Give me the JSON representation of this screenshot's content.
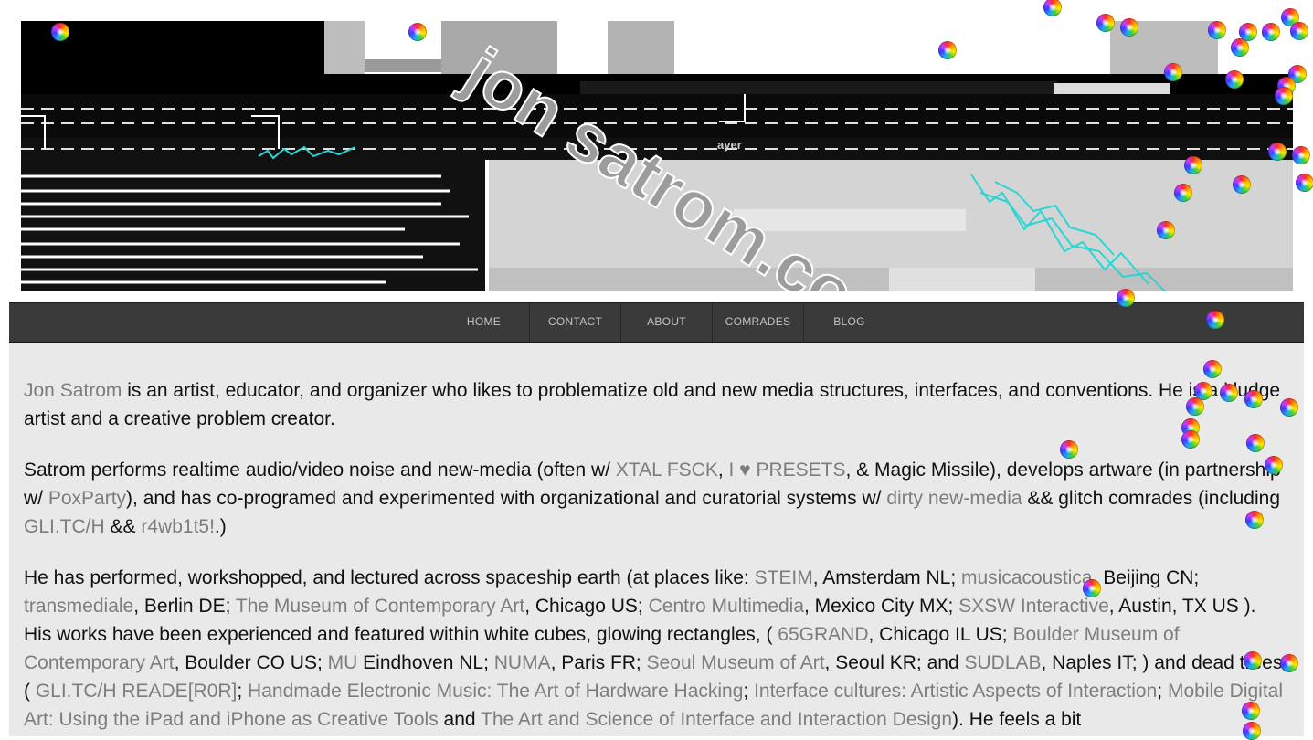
{
  "header": {
    "banner_text": "jon satrom.com",
    "banner_fragment": "ayer"
  },
  "nav": {
    "items": [
      "HOME",
      "CONTACT",
      "ABOUT",
      "COMRADES",
      "BLOG"
    ]
  },
  "intro": {
    "name_link": "Jon Satrom",
    "text_1": " is an artist, educator, and organizer who likes to problematize old and new media structures, interfaces, and conventions. He is a kludge artist and a creative problem creator."
  },
  "performs": {
    "t1": "Satrom performs realtime audio/video noise and new-media (often w/ ",
    "link_xtal": "XTAL FSCK",
    "t2": ", ",
    "link_presets": "I ♥ PRESETS",
    "t3": ", & Magic Missile), develops artware (in partnership w/ ",
    "link_poxparty": "PoxParty",
    "t4": "), and has co-programed and experimented with organizational and curatorial systems w/ ",
    "link_dirty": "dirty new-media",
    "t5": " && glitch comrades (including ",
    "link_glitch": "GLI.TC/H",
    "t6": " && ",
    "link_r4": "r4wb1t5!",
    "t7": ".)"
  },
  "performed": {
    "t1": "He has performed, workshopped, and lectured across spaceship earth (at places like: ",
    "link_steim": "STEIM",
    "t2": ", Amsterdam NL; ",
    "link_musica": "musicacoustica",
    "t3": ", Beijing CN; ",
    "link_trans": "transmediale",
    "t4": ", Berlin DE; ",
    "link_mca": "The Museum of Contemporary Art",
    "t5": ", Chicago US; ",
    "link_centro": "Centro Multimedia",
    "t6": ", Mexico City MX; ",
    "link_sxsw": "SXSW Interactive",
    "t7": ", Austin, TX US ). His works have been experienced and featured within white cubes, glowing rectangles, ( ",
    "link_65": "65GRAND",
    "t8": ", Chicago IL US; ",
    "link_boulder": "Boulder Museum of Contemporary Art",
    "t9": ", Boulder CO US; ",
    "link_mu": "MU",
    "t10": " Eindhoven NL; ",
    "link_numa": "NUMA",
    "t11": ", Paris FR; ",
    "link_seoul": "Seoul Museum of Art",
    "t12": ", Seoul KR; and ",
    "link_sudlab": "SUDLAB",
    "t13": ", Naples IT; ) and dead trees ( ",
    "link_reader": "GLI.TC/H READE[R0R]",
    "t14": "; ",
    "link_handmade": "Handmade Electronic Music: The Art of Hardware Hacking",
    "t15": "; ",
    "link_interface": "Interface cultures: Artistic Aspects of Interaction",
    "t16": "; ",
    "link_mobile": "Mobile Digital Art: Using the iPad and iPhone as Creative Tools",
    "t17": " and ",
    "link_science": "The Art and Science of Interface and Interaction Design",
    "t18": "). He feels a bit"
  },
  "colors": {
    "page_bg": "#e9e9e9",
    "nav_bg": "#3a3a3a",
    "nav_text": "#c4c4c4",
    "link": "#7d7d7d",
    "text": "#111111"
  },
  "icons": {
    "cursor": "spinning-wait-cursor-icon"
  }
}
